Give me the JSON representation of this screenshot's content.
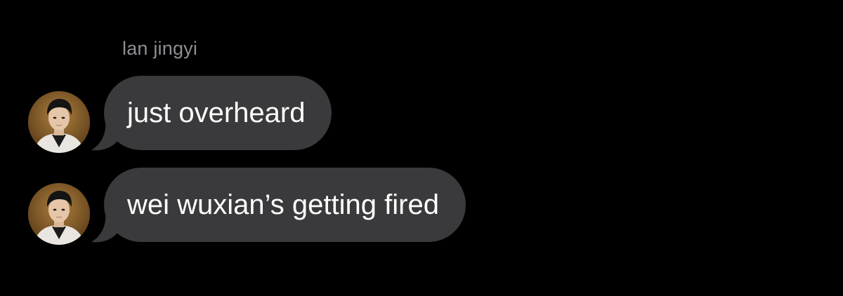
{
  "conversation": {
    "sender_name": "lan jingyi",
    "messages": [
      {
        "text": "just overheard"
      },
      {
        "text": "wei wuxian’s getting fired"
      }
    ]
  },
  "colors": {
    "background": "#000000",
    "bubble": "#3a3a3c",
    "sender_name": "#8e8e93",
    "message_text": "#ffffff"
  },
  "icons": {
    "avatar": "profile-photo"
  }
}
